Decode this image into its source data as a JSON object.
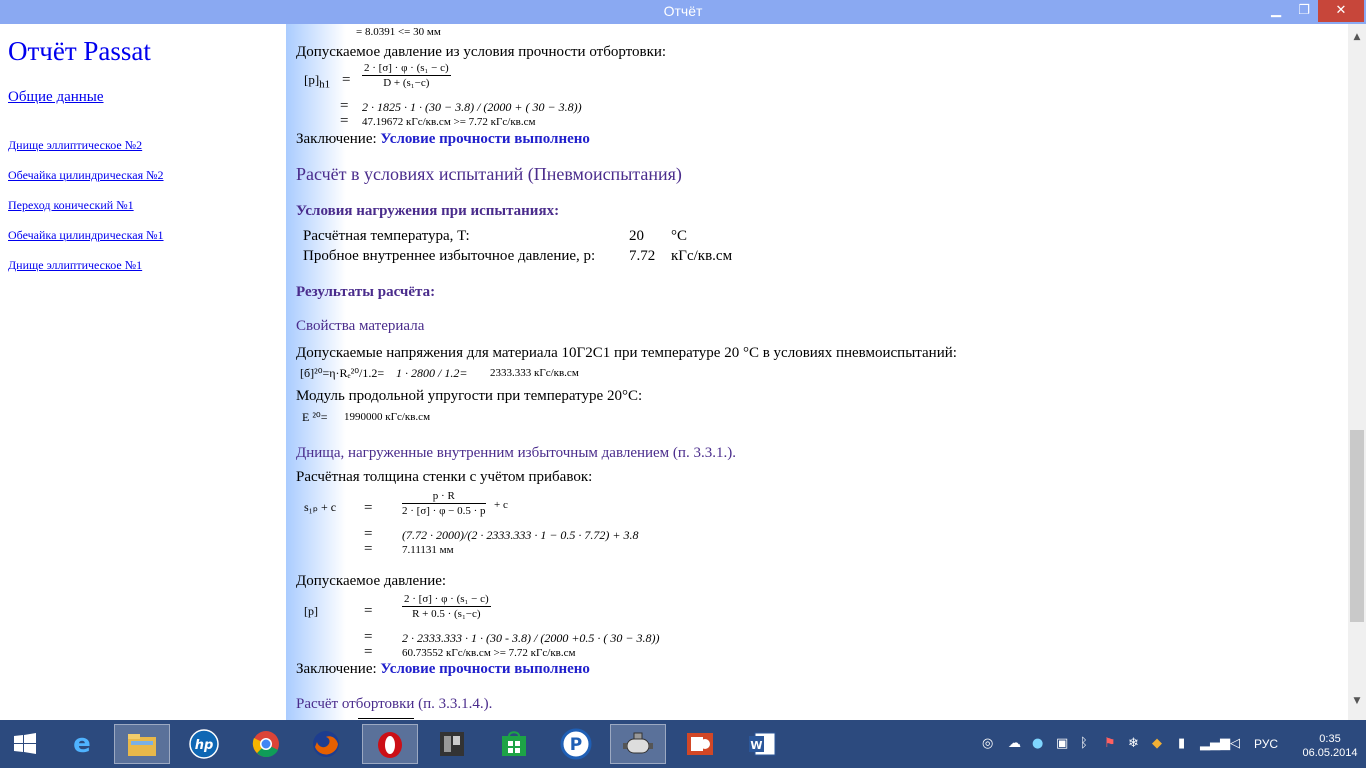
{
  "window": {
    "title": "Отчёт",
    "minimize": "▁",
    "maximize": "❐",
    "close": "✕"
  },
  "sidebar": {
    "title": "Отчёт Passat",
    "general": "Общие данные",
    "items": [
      "Днище эллиптическое №2",
      "Обечайка цилиндрическая №2",
      "Переход конический №1",
      "Обечайка цилиндрическая №1",
      "Днище эллиптическое №1"
    ]
  },
  "content": {
    "top_cut_line": "=     8.0391 <= 30 мм",
    "flange_allowed_pressure_title": "Допускаемое давление из условия прочности отбортовки:",
    "ph1_label": "[p]",
    "ph1_sub": "h1",
    "eq": "=",
    "ph1_num": "2 · [σ] · φ · (s₁ − c)",
    "ph1_den": "D + (s₁−c)",
    "ph1_subst": "2 · 1825 · 1 · (30 − 3.8) / (2000 + ( 30 − 3.8))",
    "ph1_result": "47.19672 кГс/кв.см >= 7.72 кГс/кв.см",
    "conclusion_label": "Заключение:",
    "conclusion_value": "Условие прочности выполнено",
    "test_heading": "Расчёт в условиях испытаний (Пневмоиспытания)",
    "load_conditions_title": "Условия нагружения при  испытаниях:",
    "conditions": [
      {
        "label": "Расчётная температура, T:",
        "value": "20",
        "unit": "°C"
      },
      {
        "label": "Пробное внутреннее избыточное давление, p:",
        "value": "7.72",
        "unit": "кГс/кв.см"
      }
    ],
    "results_title": "Результаты расчёта:",
    "material_title": "Свойства материала",
    "allowed_stress_text": "Допускаемые напряжения для материала 10Г2С1 при температуре 20 °С в условиях пневмоиспытаний:",
    "stress_formula": "[б]²⁰=η·Rₑ²⁰/1.2=",
    "stress_subst": "1 · 2800 / 1.2=",
    "stress_result": "2333.333 кГс/кв.см",
    "elastic_text": "Модуль продольной упругости при температуре 20°С:",
    "elastic_formula": "E ²⁰=",
    "elastic_value": "1990000 кГс/кв.см",
    "heads_title": "Днища, нагруженные внутренним избыточным давлением (п. 3.3.1.).",
    "thickness_text": "Расчётная толщина стенки с учётом прибавок:",
    "s1p_label": "s₁ₚ + c",
    "s1p_num": "p · R",
    "s1p_den": "2 · [σ] · φ − 0.5 · p",
    "s1p_plus": "+ c",
    "s1p_subst": "(7.72 · 2000)/(2 · 2333.333 · 1 − 0.5 · 7.72) + 3.8",
    "s1p_result": "7.11131 мм",
    "allowed_pressure_title": "Допускаемое давление:",
    "p_label": "[p]",
    "p_num": "2 · [σ] · φ · (s₁ − c)",
    "p_den": "R + 0.5 · (s₁−c)",
    "p_subst": "2 · 2333.333 · 1 · (30 - 3.8) / (2000 +0.5 · ( 30 − 3.8))",
    "p_result": "60.73552 кГс/кв.см >= 7.72 кГс/кв.см",
    "flange_calc_title": "Расчёт отбортовки (п. 3.3.1.4.)."
  },
  "taskbar": {
    "start_icon": "windows-start-icon",
    "lang": "РУС",
    "time": "0:35",
    "date": "06.05.2014"
  }
}
